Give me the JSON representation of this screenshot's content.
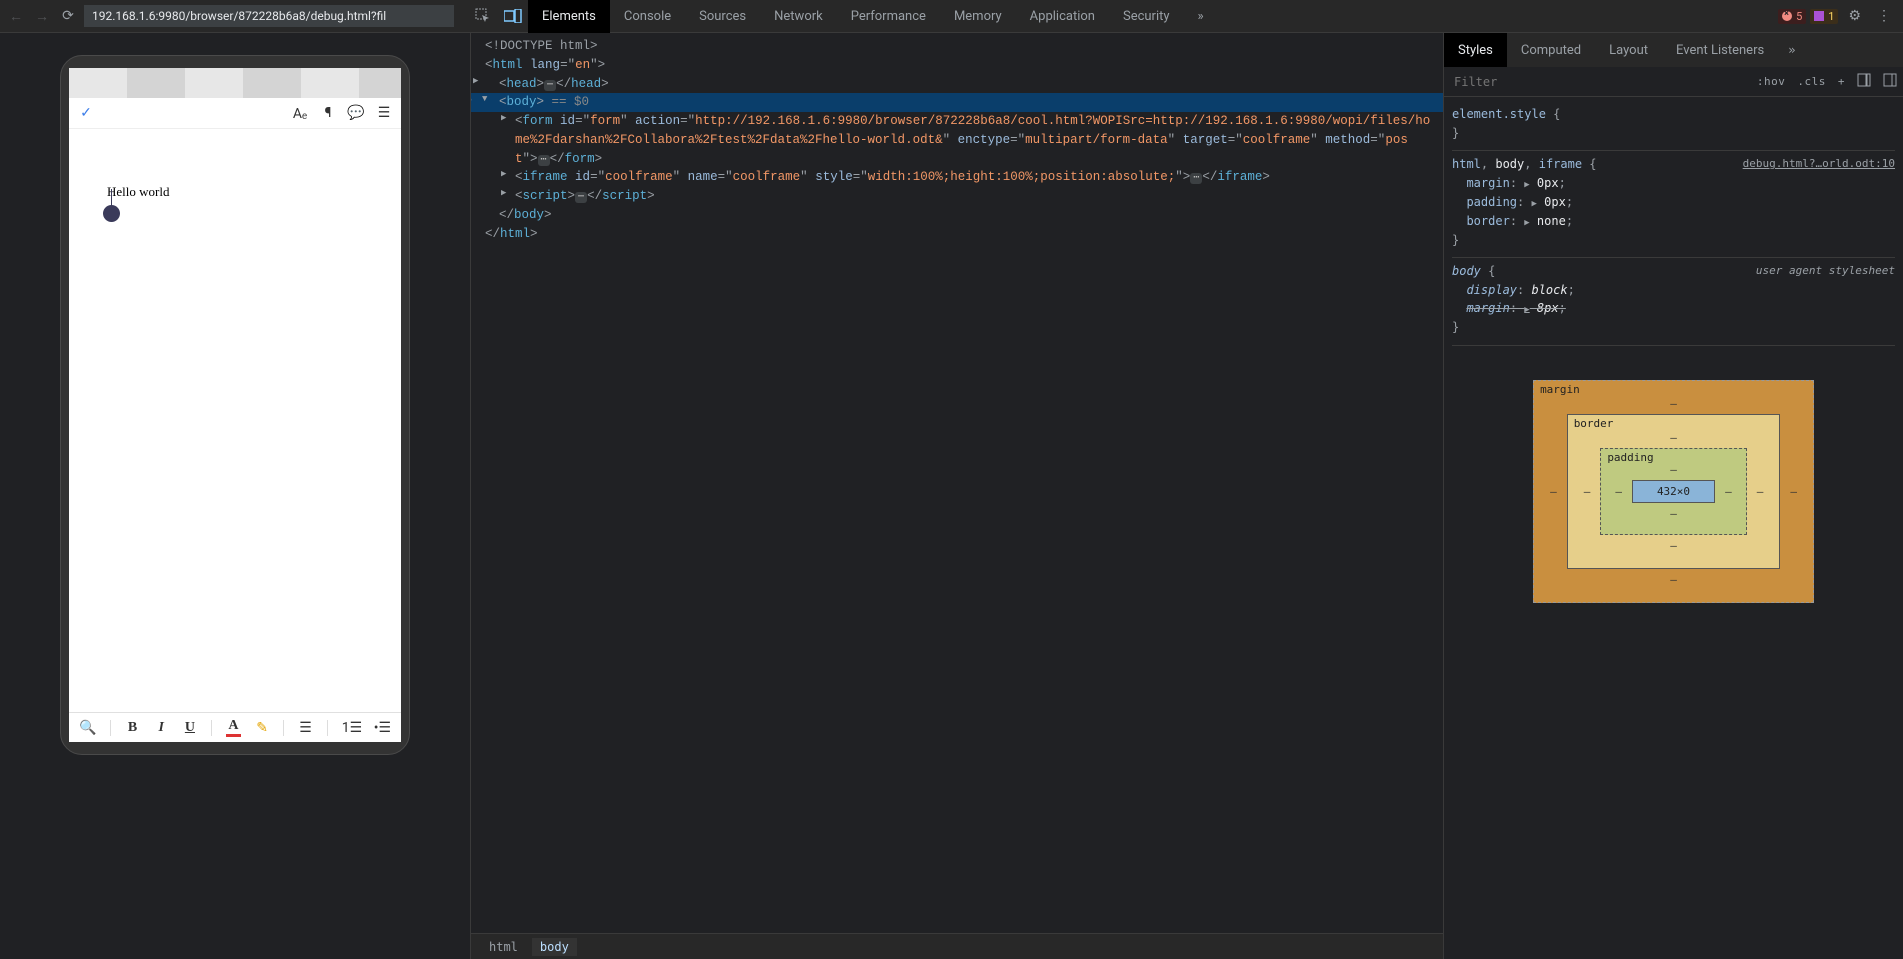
{
  "nav": {
    "url": "192.168.1.6:9980/browser/872228b6a8/debug.html?fil"
  },
  "main_tabs": {
    "elements": "Elements",
    "console": "Console",
    "sources": "Sources",
    "network": "Network",
    "performance": "Performance",
    "memory": "Memory",
    "application": "Application",
    "security": "Security"
  },
  "errors": {
    "count": "5"
  },
  "warnings": {
    "count": "1"
  },
  "preview": {
    "doc_text": "Hello world"
  },
  "dom": {
    "doctype": "<!DOCTYPE html>",
    "html_open": "html",
    "html_attr": "lang",
    "html_val": "en",
    "head": "head",
    "body": "body",
    "body_sel": " == $0",
    "form_id": "form",
    "form_action": "http://192.168.1.6:9980/browser/872228b6a8/cool.html?WOPISrc=http://192.168.1.6:9980/wopi/files/home%2Fdarshan%2FCollabora%2Ftest%2Fdata%2Fhello-world.odt&",
    "form_enctype": "multipart/form-data",
    "form_target": "coolframe",
    "form_method": "post",
    "iframe_id": "coolframe",
    "iframe_name": "coolframe",
    "iframe_style": "width:100%;height:100%;position:absolute;",
    "script": "script"
  },
  "crumb": {
    "l0": "html",
    "l1": "body"
  },
  "styles_tabs": {
    "styles": "Styles",
    "computed": "Computed",
    "layout": "Layout",
    "listeners": "Event Listeners"
  },
  "filter": {
    "placeholder": "Filter",
    "hov": ":hov",
    "cls": ".cls"
  },
  "rules": {
    "elstyle": "element.style",
    "r1_src": "debug.html?…orld.odt:10",
    "r1_sel": "html, body, iframe",
    "r1_p1": "margin",
    "r1_v1": "0px",
    "r1_p2": "padding",
    "r1_v2": "0px",
    "r1_p3": "border",
    "r1_v3": "none",
    "r2_src": "user agent stylesheet",
    "r2_sel": "body",
    "r2_p1": "display",
    "r2_v1": "block",
    "r2_p2": "margin",
    "r2_v2": "8px"
  },
  "box": {
    "margin": "margin",
    "border": "border",
    "padding": "padding",
    "content": "432×0",
    "dash": "–"
  }
}
